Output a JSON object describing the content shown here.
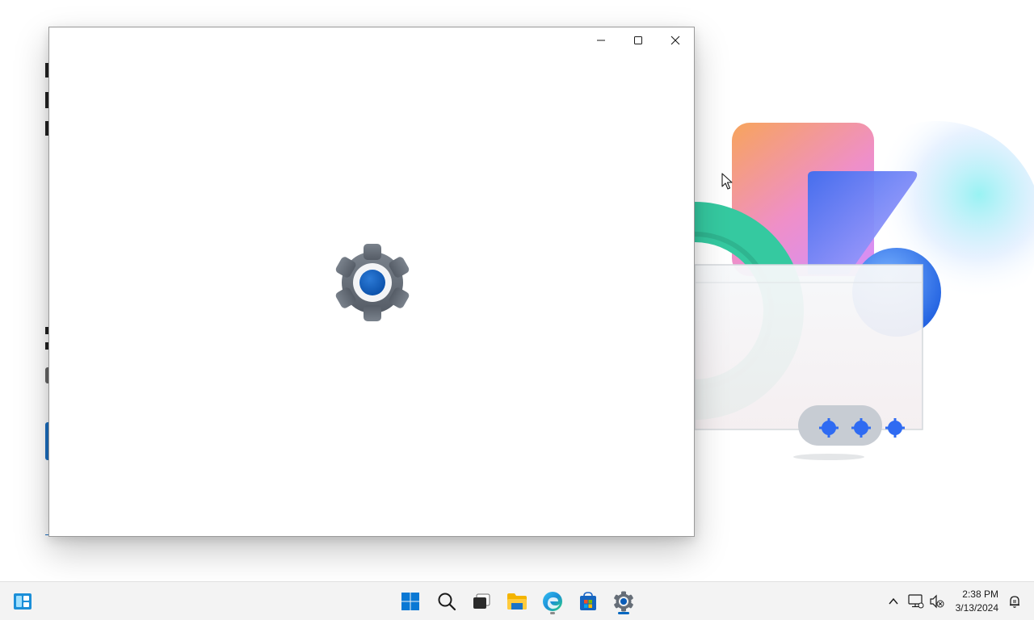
{
  "window": {
    "controls": {
      "minimize_icon": "minimize-icon",
      "maximize_icon": "maximize-icon",
      "close_icon": "close-icon"
    },
    "splash_icon": "settings-gear-icon"
  },
  "taskbar": {
    "items": [
      {
        "name": "widgets",
        "icon": "widgets-icon"
      },
      {
        "name": "start",
        "icon": "windows-logo-icon"
      },
      {
        "name": "search",
        "icon": "search-icon"
      },
      {
        "name": "task-view",
        "icon": "task-view-icon"
      },
      {
        "name": "file-explorer",
        "icon": "folder-icon"
      },
      {
        "name": "edge",
        "icon": "edge-icon",
        "running": true
      },
      {
        "name": "store",
        "icon": "store-icon"
      },
      {
        "name": "settings",
        "icon": "gear-icon",
        "active": true
      }
    ],
    "tray": {
      "icons": [
        "chevron-up-icon",
        "network-icon",
        "volume-muted-icon"
      ],
      "time": "2:38 PM",
      "date": "3/13/2024",
      "notification_icon": "notification-icon"
    }
  },
  "colors": {
    "accent": "#0067c0",
    "taskbar_bg": "#f3f3f3",
    "gear_gray": "#6b7280",
    "gear_blue": "#0a5cb8"
  }
}
